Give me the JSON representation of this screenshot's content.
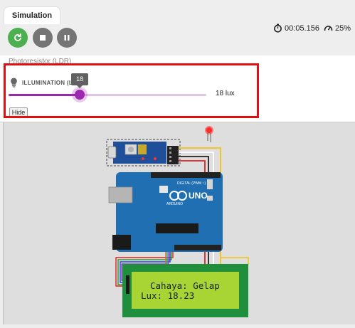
{
  "tab": {
    "label": "Simulation"
  },
  "controls": {
    "restart": "restart-icon",
    "stop": "stop-icon",
    "pause": "pause-icon"
  },
  "status": {
    "time": "00:05.156",
    "speed": "25%"
  },
  "panel": {
    "title": "Photoresistor (LDR)",
    "slider_label": "ILLUMINATION (LUX)",
    "value": 18,
    "value_text": "18",
    "value_display": "18 lux",
    "hide_label": "Hide"
  },
  "board": {
    "model": "UNO",
    "brand": "ARDUINO",
    "digital_label": "DIGITAL (PWM ~)"
  },
  "lcd": {
    "line1": "Cahaya: Gelap",
    "line2": "Lux: 18.23"
  },
  "colors": {
    "accent": "#9c27b0",
    "highlight": "#e01010",
    "play": "#4caf50",
    "board": "#1f6fb2",
    "lcd_screen": "#a9d534"
  }
}
